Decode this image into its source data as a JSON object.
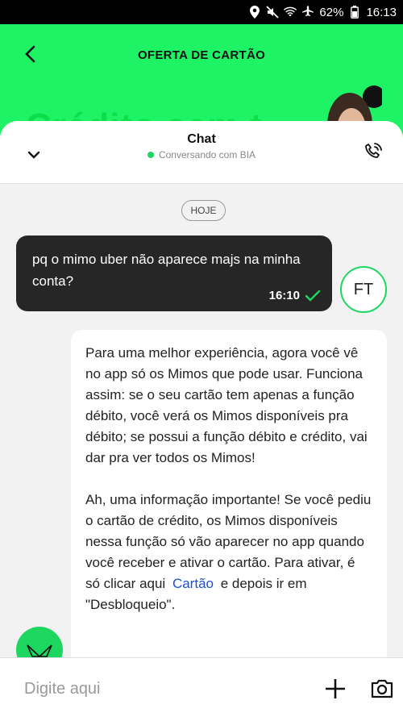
{
  "status_bar": {
    "battery": "62%",
    "time": "16:13",
    "icons": [
      "location-icon",
      "mute-icon",
      "wifi-icon",
      "airplane-icon",
      "battery-icon"
    ]
  },
  "header": {
    "title": "OFERTA DE CARTÃO",
    "back_icon": "chevron-left-icon",
    "promo_text": "Crédito sem t",
    "background_color": "#1ef366"
  },
  "chat": {
    "title": "Chat",
    "status": "Conversando com BIA",
    "status_color": "#1ed760",
    "collapse_icon": "chevron-down-icon",
    "call_icon": "phone-call-icon",
    "date_label": "HOJE",
    "messages": [
      {
        "sender": "user",
        "text": "pq o mimo uber não aparece majs na minha conta?",
        "time": "16:10",
        "status_icon": "check-icon",
        "avatar_initials": "FT"
      },
      {
        "sender": "bot",
        "paragraph_1": "Para uma melhor experiência, agora você vê no app só os Mimos que pode usar. Funciona assim: se o seu cartão tem apenas a função débito, você verá os Mimos disponíveis pra débito; se possui a função débito e crédito, vai dar pra ver todos os Mimos!",
        "paragraph_2_before_link": "Ah, uma informação importante! Se você pediu o cartão de crédito, os Mimos disponíveis nessa função só vão aparecer no app quando você receber e ativar o cartão. Para ativar, é só clicar aqui",
        "link_text": "Cartão",
        "paragraph_2_after_link": "e depois ir em \"Desbloqueio\".",
        "avatar_icon": "bia-logo-icon"
      }
    ]
  },
  "input": {
    "placeholder": "Digite aqui",
    "value": "",
    "attach_icon": "plus-icon",
    "camera_icon": "camera-icon"
  },
  "colors": {
    "accent": "#1ed760",
    "user_bubble": "#262626",
    "link": "#1a4fd8"
  }
}
